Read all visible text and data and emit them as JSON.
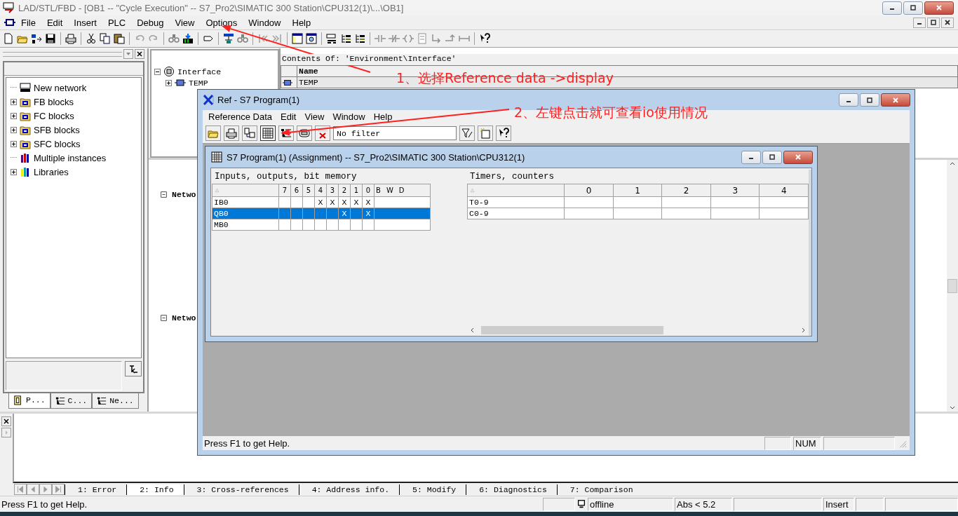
{
  "window": {
    "title": "LAD/STL/FBD  - [OB1 -- \"Cycle Execution\" -- S7_Pro2\\SIMATIC 300 Station\\CPU312(1)\\...\\OB1]"
  },
  "menu": [
    "File",
    "Edit",
    "Insert",
    "PLC",
    "Debug",
    "View",
    "Options",
    "Window",
    "Help"
  ],
  "catalog": {
    "items": [
      {
        "label": "New network",
        "collapsed": false
      },
      {
        "label": "FB blocks",
        "collapsed": true
      },
      {
        "label": "FC blocks",
        "collapsed": true
      },
      {
        "label": "SFB blocks",
        "collapsed": true
      },
      {
        "label": "SFC blocks",
        "collapsed": true
      },
      {
        "label": "Multiple instances",
        "collapsed": false
      },
      {
        "label": "Libraries",
        "collapsed": true
      }
    ],
    "tabs": [
      {
        "label": "P...",
        "selected": true
      },
      {
        "label": "C...",
        "selected": false
      },
      {
        "label": "Ne...",
        "selected": false
      }
    ]
  },
  "interface_tree": {
    "label": "Interface",
    "expanded": true,
    "children": [
      {
        "label": "TEMP",
        "expanded": false
      }
    ]
  },
  "contents": {
    "header": "Contents Of: 'Environment\\Interface'",
    "column": "Name",
    "rows": [
      "TEMP"
    ]
  },
  "editor": {
    "networks": [
      "Netwo",
      "Netwo"
    ]
  },
  "ref_window": {
    "title": "Ref - S7 Program(1)",
    "menu": [
      "Reference Data",
      "Edit",
      "View",
      "Window",
      "Help"
    ],
    "filter": "No filter",
    "status": "Press F1 to get Help.",
    "num": "NUM",
    "child": {
      "title": "S7 Program(1) (Assignment) -- S7_Pro2\\SIMATIC 300 Station\\CPU312(1)",
      "io": {
        "title": "Inputs, outputs, bit memory",
        "bits": [
          "7",
          "6",
          "5",
          "4",
          "3",
          "2",
          "1",
          "0"
        ],
        "sizes": [
          "B",
          "W",
          "D"
        ],
        "rows": [
          {
            "address": "IB0",
            "cells": [
              null,
              null,
              null,
              "X",
              "X",
              "X",
              "X",
              "X"
            ],
            "selected": false
          },
          {
            "address": "QB0",
            "cells": [
              null,
              null,
              null,
              null,
              null,
              "X",
              null,
              "X"
            ],
            "selected": true
          },
          {
            "address": "MB0",
            "cells": [
              null,
              null,
              null,
              null,
              null,
              null,
              null,
              null
            ],
            "selected": false
          }
        ]
      },
      "timers": {
        "title": "Timers, counters",
        "columns": [
          "0",
          "1",
          "2",
          "3",
          "4"
        ],
        "rows": [
          "T0-9",
          "C0-9"
        ]
      }
    }
  },
  "output_tabs": [
    {
      "label": "1: Error",
      "selected": false
    },
    {
      "label": "2: Info",
      "selected": true
    },
    {
      "label": "3: Cross-references",
      "selected": false
    },
    {
      "label": "4: Address info.",
      "selected": false
    },
    {
      "label": "5: Modify",
      "selected": false
    },
    {
      "label": "6: Diagnostics",
      "selected": false
    },
    {
      "label": "7: Comparison",
      "selected": false
    }
  ],
  "status_bar": {
    "help": "Press F1 to get Help.",
    "mode": "offline",
    "abs": "Abs < 5.2",
    "insert": "Insert"
  },
  "annotations": [
    {
      "text": "1、选择Reference data ->display"
    },
    {
      "text": "2、左键点击就可查看io使用情况"
    }
  ]
}
